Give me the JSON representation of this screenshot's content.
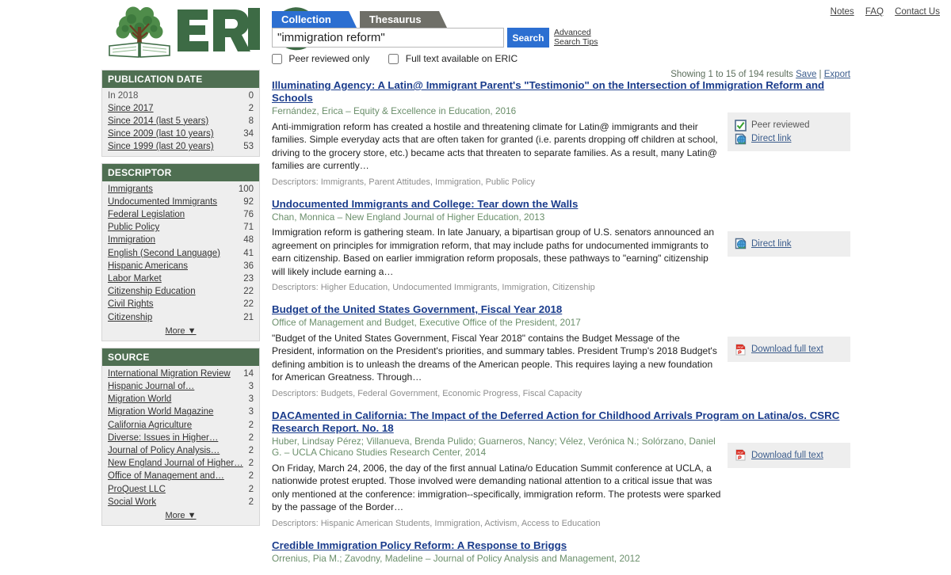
{
  "topnav": {
    "items": [
      {
        "label": "Notes",
        "name": "notes-link"
      },
      {
        "label": "FAQ",
        "name": "faq-link"
      },
      {
        "label": "Contact Us",
        "name": "contact-us-link"
      }
    ]
  },
  "brand": {
    "name": "ERIC",
    "logo_icon": "tree-over-book-icon",
    "wordmark_color": "#3d6b45"
  },
  "search": {
    "tabs": [
      {
        "label": "Collection",
        "active": true
      },
      {
        "label": "Thesaurus",
        "active": false
      }
    ],
    "query": "\"immigration reform\"",
    "placeholder": "",
    "button_label": "Search",
    "advanced_label": "Advanced",
    "tips_label": "Search Tips",
    "filters": [
      {
        "label": "Peer reviewed only",
        "checked": false
      },
      {
        "label": "Full text available on ERIC",
        "checked": false
      }
    ]
  },
  "results_bar": {
    "showing_text": "Showing 1 to 15 of 194 results",
    "save_label": "Save",
    "separator": "|",
    "export_label": "Export"
  },
  "sidebar": {
    "facets": [
      {
        "title": "PUBLICATION DATE",
        "more_label": "More ▼",
        "has_more": false,
        "items": [
          {
            "label": "In 2018",
            "count": "0",
            "link": false
          },
          {
            "label": "Since 2017",
            "count": "2",
            "link": true
          },
          {
            "label": "Since 2014 (last 5 years)",
            "count": "8",
            "link": true
          },
          {
            "label": "Since 2009 (last 10 years)",
            "count": "34",
            "link": true
          },
          {
            "label": "Since 1999 (last 20 years)",
            "count": "53",
            "link": true
          }
        ]
      },
      {
        "title": "DESCRIPTOR",
        "more_label": "More ▼",
        "has_more": true,
        "items": [
          {
            "label": "Immigrants",
            "count": "100",
            "link": true
          },
          {
            "label": "Undocumented Immigrants",
            "count": "92",
            "link": true
          },
          {
            "label": "Federal Legislation",
            "count": "76",
            "link": true
          },
          {
            "label": "Public Policy",
            "count": "71",
            "link": true
          },
          {
            "label": "Immigration",
            "count": "48",
            "link": true
          },
          {
            "label": "English (Second Language)",
            "count": "41",
            "link": true
          },
          {
            "label": "Hispanic Americans",
            "count": "36",
            "link": true
          },
          {
            "label": "Labor Market",
            "count": "23",
            "link": true
          },
          {
            "label": "Citizenship Education",
            "count": "22",
            "link": true
          },
          {
            "label": "Civil Rights",
            "count": "22",
            "link": true
          },
          {
            "label": "Citizenship",
            "count": "21",
            "link": true
          }
        ]
      },
      {
        "title": "SOURCE",
        "more_label": "More ▼",
        "has_more": true,
        "items": [
          {
            "label": "International Migration Review",
            "count": "14",
            "link": true
          },
          {
            "label": "Hispanic Journal of…",
            "count": "3",
            "link": true
          },
          {
            "label": "Migration World",
            "count": "3",
            "link": true
          },
          {
            "label": "Migration World Magazine",
            "count": "3",
            "link": true
          },
          {
            "label": "California Agriculture",
            "count": "2",
            "link": true
          },
          {
            "label": "Diverse: Issues in Higher…",
            "count": "2",
            "link": true
          },
          {
            "label": "Journal of Policy Analysis…",
            "count": "2",
            "link": true
          },
          {
            "label": "New England Journal of Higher…",
            "count": "2",
            "link": true
          },
          {
            "label": "Office of Management and…",
            "count": "2",
            "link": true
          },
          {
            "label": "ProQuest LLC",
            "count": "2",
            "link": true
          },
          {
            "label": "Social Work",
            "count": "2",
            "link": true
          }
        ]
      }
    ]
  },
  "results": [
    {
      "title": "Illuminating Agency: A Latin@ Immigrant Parent's \"Testimonio\" on the Intersection of Immigration Reform and Schools",
      "meta": "Fernández, Erica – Equity & Excellence in Education, 2016",
      "abstract": "Anti-immigration reform has created a hostile and threatening climate for Latin@ immigrants and their families. Simple everyday acts that are often taken for granted (i.e. parents dropping off children at school, driving to the grocery store, etc.) became acts that threaten to separate families. As a result, many Latin@ families are currently…",
      "descriptors": "Descriptors: Immigrants, Parent Attitudes, Immigration, Public Policy",
      "actions": [
        {
          "icon": "peer-reviewed-icon",
          "label": "Peer reviewed",
          "link": false
        },
        {
          "icon": "direct-link-icon",
          "label": "Direct link",
          "link": true
        }
      ]
    },
    {
      "title": "Undocumented Immigrants and College: Tear down the Walls",
      "meta": "Chan, Monnica – New England Journal of Higher Education, 2013",
      "abstract": "Immigration reform is gathering steam. In late January, a bipartisan group of U.S. senators announced an agreement on principles for immigration reform, that may include paths for undocumented immigrants to earn citizenship. Based on earlier immigration reform proposals, these pathways to \"earning\" citizenship will likely include earning a…",
      "descriptors": "Descriptors: Higher Education, Undocumented Immigrants, Immigration, Citizenship",
      "actions": [
        {
          "icon": "direct-link-icon",
          "label": "Direct link",
          "link": true
        }
      ]
    },
    {
      "title": "Budget of the United States Government, Fiscal Year 2018",
      "meta": "Office of Management and Budget, Executive Office of the President, 2017",
      "abstract": "\"Budget of the United States Government, Fiscal Year 2018\" contains the Budget Message of the President, information on the President's priorities, and summary tables. President Trump's 2018 Budget's defining ambition is to unleash the dreams of the American people. This requires laying a new foundation for American Greatness. Through…",
      "descriptors": "Descriptors: Budgets, Federal Government, Economic Progress, Fiscal Capacity",
      "actions": [
        {
          "icon": "pdf-icon",
          "label": "Download full text",
          "link": true
        }
      ]
    },
    {
      "title": "DACAmented in California: The Impact of the Deferred Action for Childhood Arrivals Program on Latina/os. CSRC Research Report. No. 18",
      "meta": "Huber, Lindsay Pérez; Villanueva, Brenda Pulido; Guarneros, Nancy; Vélez, Verónica N.; Solórzano, Daniel G. – UCLA Chicano Studies Research Center, 2014",
      "abstract": "On Friday, March 24, 2006, the day of the first annual Latina/o Education Summit conference at UCLA, a nationwide protest erupted. Those involved were demanding national attention to a critical issue that was only mentioned at the conference: immigration--specifically, immigration reform. The protests were sparked by the passage of the Border…",
      "descriptors": "Descriptors: Hispanic American Students, Immigration, Activism, Access to Education",
      "actions": [
        {
          "icon": "pdf-icon",
          "label": "Download full text",
          "link": true
        }
      ]
    },
    {
      "title": "Credible Immigration Policy Reform: A Response to Briggs",
      "meta": "Orrenius, Pia M.; Zavodny, Madeline – Journal of Policy Analysis and Management, 2012",
      "abstract": "",
      "descriptors": "",
      "actions": []
    }
  ]
}
